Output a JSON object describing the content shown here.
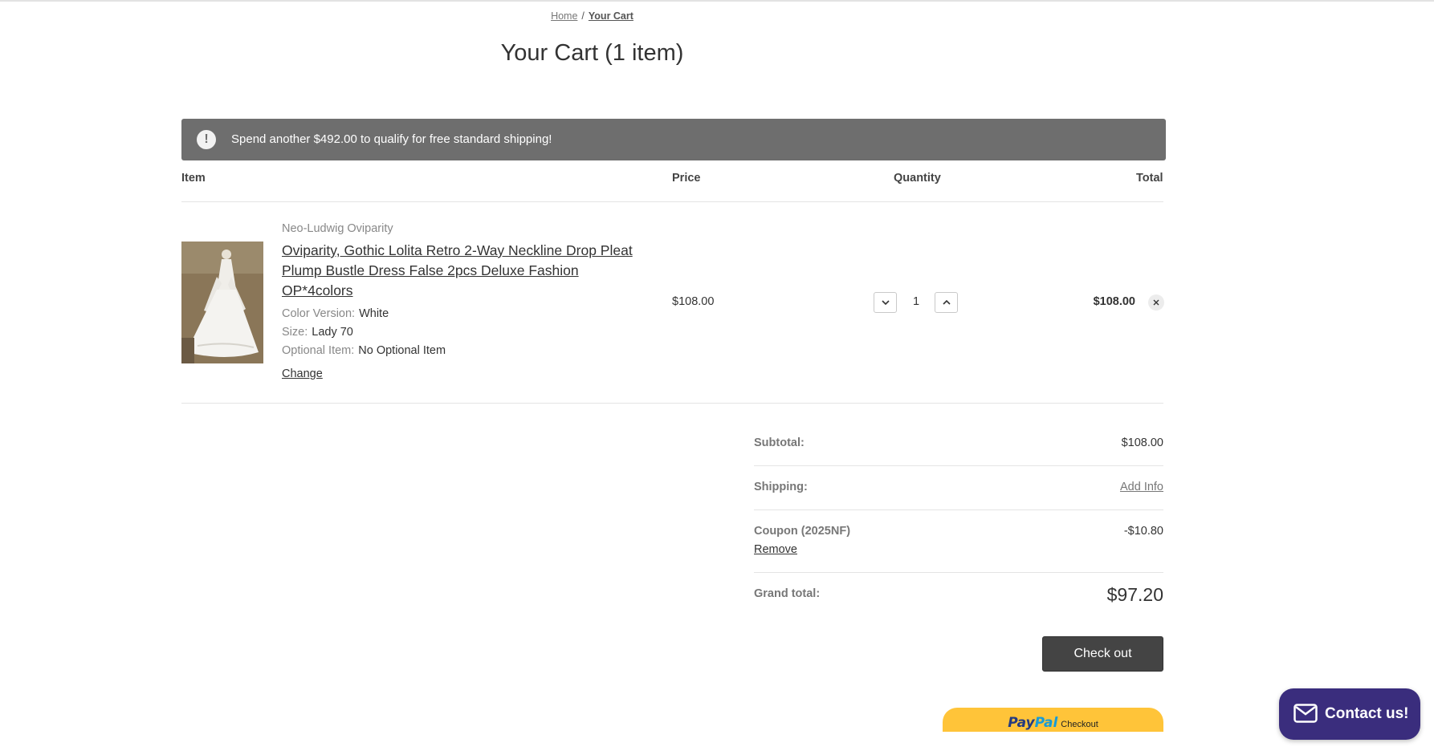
{
  "breadcrumb": {
    "home": "Home",
    "separator": "/",
    "current": "Your Cart"
  },
  "page_title": "Your Cart (1 item)",
  "notice": {
    "icon": "exclamation-icon",
    "text": "Spend another $492.00 to qualify for free standard shipping!"
  },
  "columns": {
    "item": "Item",
    "price": "Price",
    "quantity": "Quantity",
    "total": "Total"
  },
  "cart_item": {
    "brand": "Neo-Ludwig Oviparity",
    "name": "Oviparity, Gothic Lolita Retro 2-Way Neckline Drop Pleat Plump Bustle Dress False 2pcs Deluxe Fashion OP*4colors",
    "options": [
      {
        "label": "Color Version:",
        "value": "White"
      },
      {
        "label": "Size:",
        "value": "Lady 70"
      },
      {
        "label": "Optional Item:",
        "value": "No Optional Item"
      }
    ],
    "change_label": "Change",
    "price": "$108.00",
    "quantity": "1",
    "total": "$108.00"
  },
  "summary": {
    "subtotal_label": "Subtotal:",
    "subtotal_value": "$108.00",
    "shipping_label": "Shipping:",
    "shipping_value": "Add Info",
    "coupon_label": "Coupon (2025NF)",
    "coupon_remove": "Remove",
    "coupon_value": "-$10.80",
    "grand_total_label": "Grand total:",
    "grand_total_value": "$97.20"
  },
  "checkout_label": "Check out",
  "paypal": {
    "brand_part1": "Pay",
    "brand_part2": "Pal",
    "label": "Checkout"
  },
  "contact_label": "Contact us!",
  "colors": {
    "notice_bg": "#6e6e6e",
    "checkout_bg": "#444444",
    "paypal_bg": "#ffc439",
    "contact_bg": "#3a2d7d"
  }
}
